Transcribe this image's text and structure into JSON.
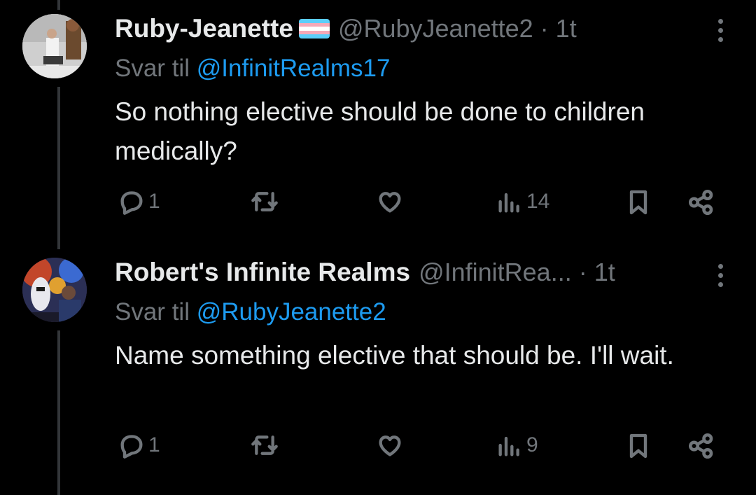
{
  "tweets": [
    {
      "name": "Ruby-Jeanette",
      "handle": "@RubyJeanette2",
      "time": "1t",
      "reply_prefix": "Svar til",
      "reply_to": "@InfinitRealms17",
      "text": "So nothing elective should be done to children medically?",
      "replies": "1",
      "views": "14",
      "icons": {
        "reply": "reply-icon",
        "retweet": "retweet-icon",
        "like": "heart-icon",
        "views": "views-icon",
        "bookmark": "bookmark-icon",
        "share": "share-icon"
      }
    },
    {
      "name": "Robert's Infinite Realms",
      "handle": "@InfinitRea...",
      "time": "1t",
      "reply_prefix": "Svar til",
      "reply_to": "@RubyJeanette2",
      "text": "Name something elective that should be.  I'll wait.",
      "replies": "1",
      "views": "9",
      "icons": {
        "reply": "reply-icon",
        "retweet": "retweet-icon",
        "like": "heart-icon",
        "views": "views-icon",
        "bookmark": "bookmark-icon",
        "share": "share-icon"
      }
    }
  ],
  "colors": {
    "background": "#000000",
    "text": "#e7e9ea",
    "muted": "#71767b",
    "link": "#1d9bf0",
    "thread_line": "#333639"
  },
  "dot_separator": "·"
}
